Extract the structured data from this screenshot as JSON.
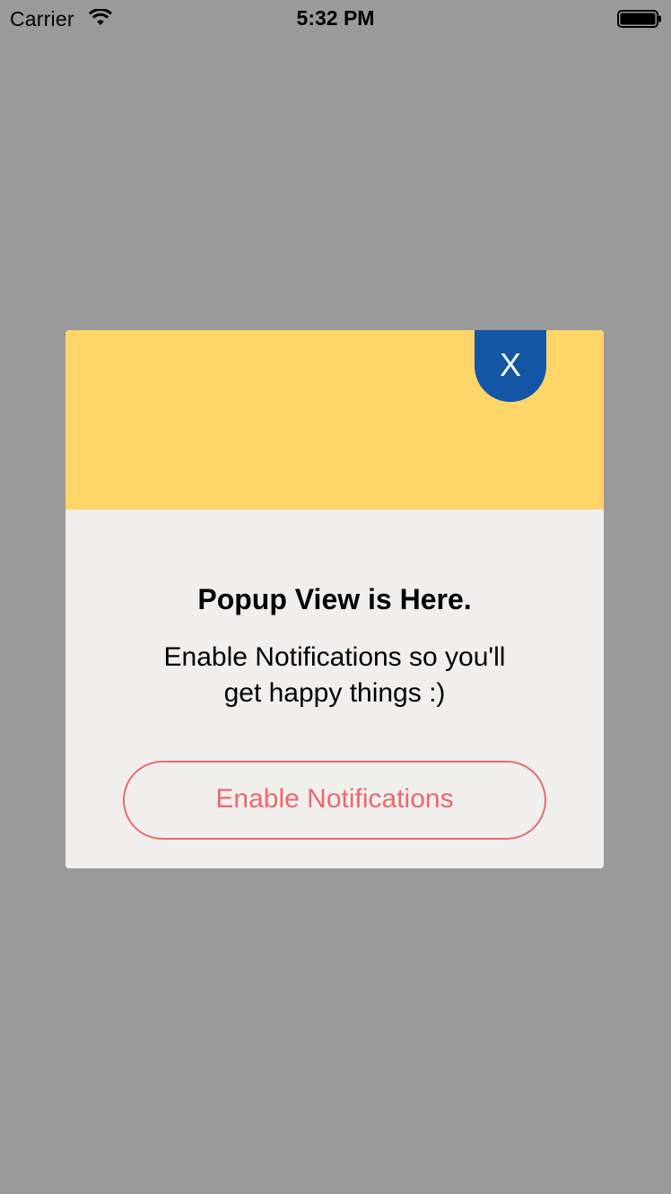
{
  "status_bar": {
    "carrier": "Carrier",
    "time": "5:32 PM",
    "wifi_icon": "wifi-icon",
    "battery_icon": "battery-full-icon"
  },
  "popup": {
    "close_label": "X",
    "title": "Popup View is Here.",
    "message_line1": "Enable Notifications so you'll",
    "message_line2": "get happy things :)",
    "button_label": "Enable Notifications"
  },
  "colors": {
    "backdrop": "#9a9a9a",
    "header": "#ffd469",
    "close_button": "#1356a6",
    "body": "#f1efee",
    "accent": "#ea6a68"
  }
}
